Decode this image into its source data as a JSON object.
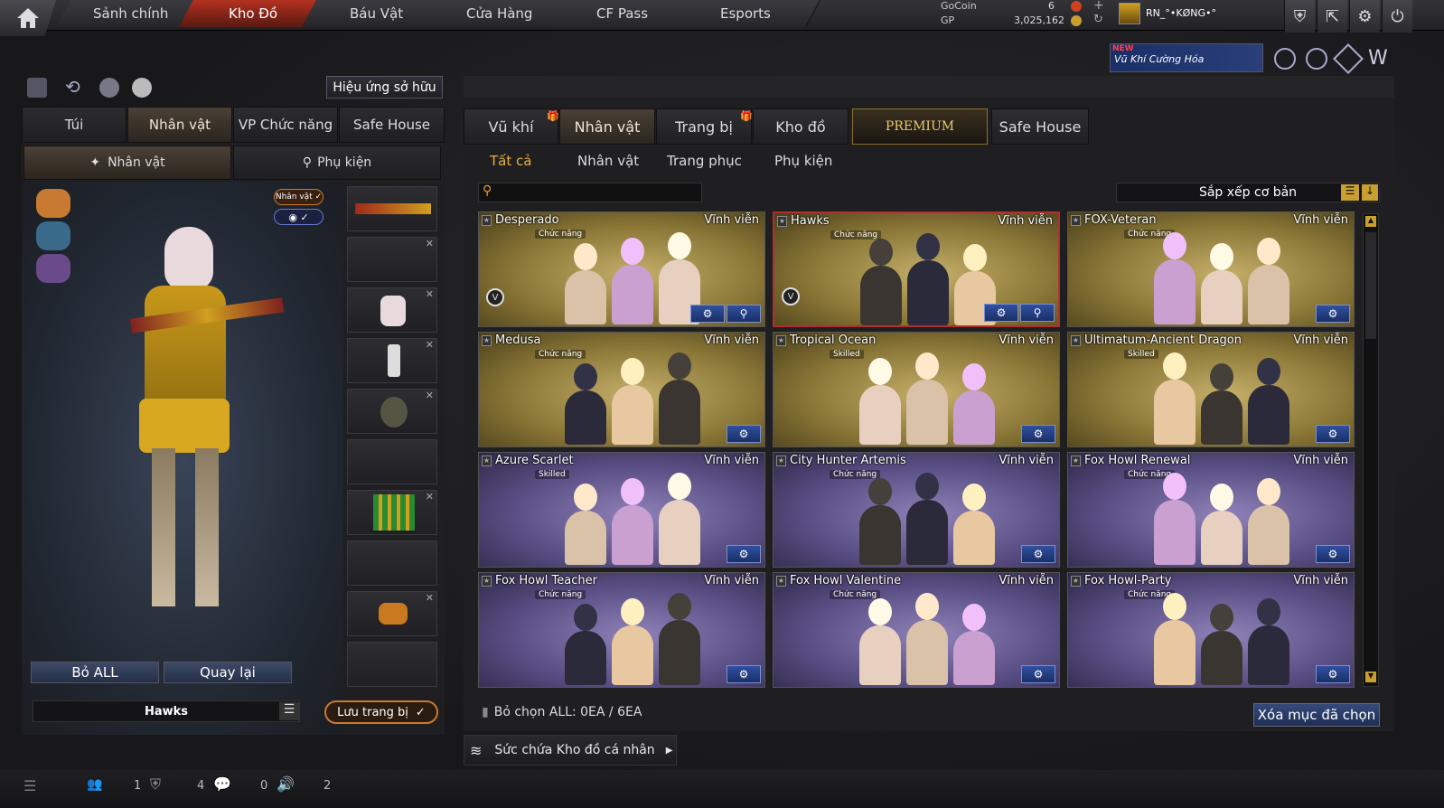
{
  "nav": {
    "tabs": [
      "Sảnh chính",
      "Kho Đồ",
      "Báu Vật",
      "Cửa Hàng",
      "CF Pass",
      "Esports"
    ],
    "active_index": 1
  },
  "currency": {
    "gocoin_label": "GoCoin",
    "gocoin_value": "6",
    "gp_label": "GP",
    "gp_value": "3,025,162"
  },
  "player": {
    "name": "RN_°•KØNG•°"
  },
  "promo": {
    "new_badge": "NEW",
    "title": "Vũ Khí Cường Hóa"
  },
  "left": {
    "effects_button": "Hiệu ứng sở hữu",
    "tabs": [
      "Túi",
      "Nhân vật",
      "VP Chức năng",
      "Safe House"
    ],
    "active_tab": 1,
    "subtabs": [
      "Nhân vật",
      "Phụ kiện"
    ],
    "char_badge": "Nhân vật ✓",
    "remove_all": "Bỏ ALL",
    "back": "Quay lại",
    "preset_name": "Hawks",
    "save_button": "Lưu trang bị"
  },
  "right": {
    "tabs": [
      "Vũ khí",
      "Nhân vật",
      "Trang bị",
      "Kho đồ",
      "PREMIUM",
      "Safe House"
    ],
    "active_tab": 1,
    "filters": [
      "Tất cả",
      "Nhân vật",
      "Trang phục",
      "Phụ kiện"
    ],
    "active_filter": 0,
    "search_placeholder": "",
    "sort_label": "Sắp xếp cơ bản",
    "deselect_text": "Bỏ chọn ALL: 0EA / 6EA",
    "delete_selected": "Xóa mục đã chọn",
    "capacity": "Sức chứa Kho đồ cá nhân"
  },
  "items": [
    {
      "name": "Desperado",
      "duration": "Vĩnh viễn",
      "tag": "Chức năng",
      "theme": "gold",
      "badge": true,
      "search": true
    },
    {
      "name": "Hawks",
      "duration": "Vĩnh viễn",
      "tag": "Chức năng",
      "theme": "gold",
      "badge": true,
      "search": true,
      "selected": true
    },
    {
      "name": "FOX-Veteran",
      "duration": "Vĩnh viễn",
      "tag": "Chức năng",
      "theme": "gold"
    },
    {
      "name": "Medusa",
      "duration": "Vĩnh viễn",
      "tag": "Chức năng",
      "theme": "gold"
    },
    {
      "name": "Tropical Ocean",
      "duration": "Vĩnh viễn",
      "tag": "Skilled",
      "theme": "gold"
    },
    {
      "name": "Ultimatum-Ancient Dragon",
      "duration": "Vĩnh viễn",
      "tag": "Skilled",
      "theme": "gold"
    },
    {
      "name": "Azure Scarlet",
      "duration": "Vĩnh viễn",
      "tag": "Skilled",
      "theme": "purple"
    },
    {
      "name": "City Hunter Artemis",
      "duration": "Vĩnh viễn",
      "tag": "Chức năng",
      "theme": "purple"
    },
    {
      "name": "Fox Howl Renewal",
      "duration": "Vĩnh viễn",
      "tag": "Chức năng",
      "theme": "purple"
    },
    {
      "name": "Fox Howl Teacher",
      "duration": "Vĩnh viễn",
      "tag": "Chức năng",
      "theme": "purple"
    },
    {
      "name": "Fox Howl Valentine",
      "duration": "Vĩnh viễn",
      "tag": "Chức năng",
      "theme": "purple"
    },
    {
      "name": "Fox Howl-Party",
      "duration": "Vĩnh viễn",
      "tag": "Chức năng",
      "theme": "purple"
    }
  ],
  "status": {
    "count1": "1",
    "count2": "4",
    "count3": "0",
    "count4": "2"
  }
}
